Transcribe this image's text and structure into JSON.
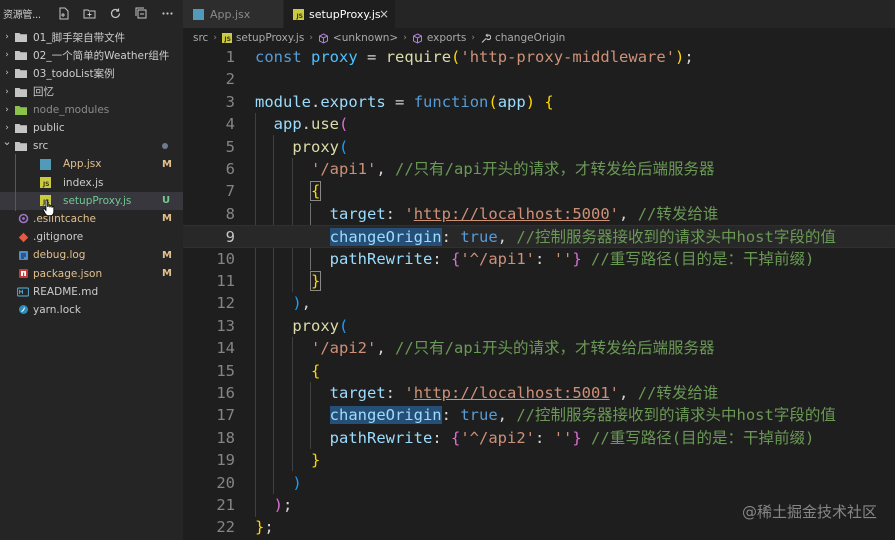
{
  "sidebar": {
    "title": "资源管...",
    "actions": [
      "new-file-icon",
      "new-folder-icon",
      "refresh-icon",
      "collapse-all-icon",
      "more-icon"
    ],
    "items": [
      {
        "label": "01_脚手架自带文件",
        "type": "folder",
        "expanded": false,
        "depth": 0
      },
      {
        "label": "02_一个简单的Weather组件",
        "type": "folder",
        "expanded": false,
        "depth": 0
      },
      {
        "label": "03_todoList案例",
        "type": "folder",
        "expanded": false,
        "depth": 0
      },
      {
        "label": "回忆",
        "type": "folder",
        "expanded": false,
        "depth": 0
      },
      {
        "label": "node_modules",
        "type": "folder-node",
        "expanded": false,
        "depth": 0
      },
      {
        "label": "public",
        "type": "folder",
        "expanded": false,
        "depth": 0
      },
      {
        "label": "src",
        "type": "folder",
        "expanded": true,
        "depth": 0,
        "badge": "dot"
      },
      {
        "label": "App.jsx",
        "type": "jsx",
        "depth": 1,
        "badge": "M"
      },
      {
        "label": "index.js",
        "type": "js",
        "depth": 1
      },
      {
        "label": "setupProxy.js",
        "type": "js",
        "depth": 1,
        "badge": "U",
        "selected": true
      },
      {
        "label": ".eslintcache",
        "type": "eslint",
        "depth": 0,
        "badge": "M"
      },
      {
        "label": ".gitignore",
        "type": "git",
        "depth": 0
      },
      {
        "label": "debug.log",
        "type": "log",
        "depth": 0,
        "badge": "M"
      },
      {
        "label": "package.json",
        "type": "npm",
        "depth": 0,
        "badge": "M"
      },
      {
        "label": "README.md",
        "type": "md",
        "depth": 0
      },
      {
        "label": "yarn.lock",
        "type": "yarn",
        "depth": 0
      }
    ]
  },
  "tabs": [
    {
      "label": "App.jsx",
      "icon": "react-icon",
      "active": false
    },
    {
      "label": "setupProxy.js",
      "icon": "js-icon",
      "active": true,
      "close": "×"
    }
  ],
  "breadcrumb": [
    "src",
    "setupProxy.js",
    "<unknown>",
    "exports",
    "changeOrigin"
  ],
  "editor": {
    "current_line": 9,
    "line_numbers": [
      "1",
      "2",
      "3",
      "4",
      "5",
      "6",
      "7",
      "8",
      "9",
      "10",
      "11",
      "12",
      "13",
      "14",
      "15",
      "16",
      "17",
      "18",
      "19",
      "20",
      "21",
      "22"
    ]
  },
  "code": {
    "l1": [
      "const",
      "proxy",
      "=",
      "require",
      "(",
      "'http-proxy-middleware'",
      ")",
      ";"
    ],
    "l3": [
      "module",
      ".",
      "exports",
      "=",
      "function",
      "(",
      "app",
      ")",
      "{"
    ],
    "l4": [
      "app",
      ".",
      "use",
      "("
    ],
    "l5": [
      "proxy",
      "("
    ],
    "l6": [
      "'/api1'",
      ",",
      "//只有/api开头的请求，才转发给后端服务器"
    ],
    "l7": [
      "{"
    ],
    "l8": [
      "target",
      ":",
      "'",
      "http://localhost:5000",
      "'",
      ",",
      "//转发给谁"
    ],
    "l9": [
      "changeOrigin",
      ":",
      "true",
      ",",
      "//控制服务器接收到的请求头中host字段的值"
    ],
    "l10": [
      "pathRewrite",
      ":",
      "{",
      "'^/api1'",
      ":",
      "''",
      "}",
      "//重写路径(目的是：干掉前缀)"
    ],
    "l11": [
      "}"
    ],
    "l12": [
      ")",
      ","
    ],
    "l13": [
      "proxy",
      "("
    ],
    "l14": [
      "'/api2'",
      ",",
      "//只有/api开头的请求，才转发给后端服务器"
    ],
    "l15": [
      "{"
    ],
    "l16": [
      "target",
      ":",
      "'",
      "http://localhost:5001",
      "'",
      ",",
      "//转发给谁"
    ],
    "l17": [
      "changeOrigin",
      ":",
      "true",
      ",",
      "//控制服务器接收到的请求头中host字段的值"
    ],
    "l18": [
      "pathRewrite",
      ":",
      "{",
      "'^/api2'",
      ":",
      "''",
      "}",
      "//重写路径(目的是：干掉前缀)"
    ],
    "l19": [
      "}"
    ],
    "l20": [
      ")"
    ],
    "l21": [
      ")",
      ";"
    ],
    "l22": [
      "}",
      ";"
    ]
  },
  "watermark": "@稀土掘金技术社区",
  "colors": {
    "editor_bg": "#1e1e1e",
    "sidebar_bg": "#252526",
    "keyword": "#569cd6",
    "string": "#ce9178",
    "comment": "#6a9955",
    "modified_badge": "#e2c08d",
    "untracked_badge": "#73c991"
  }
}
